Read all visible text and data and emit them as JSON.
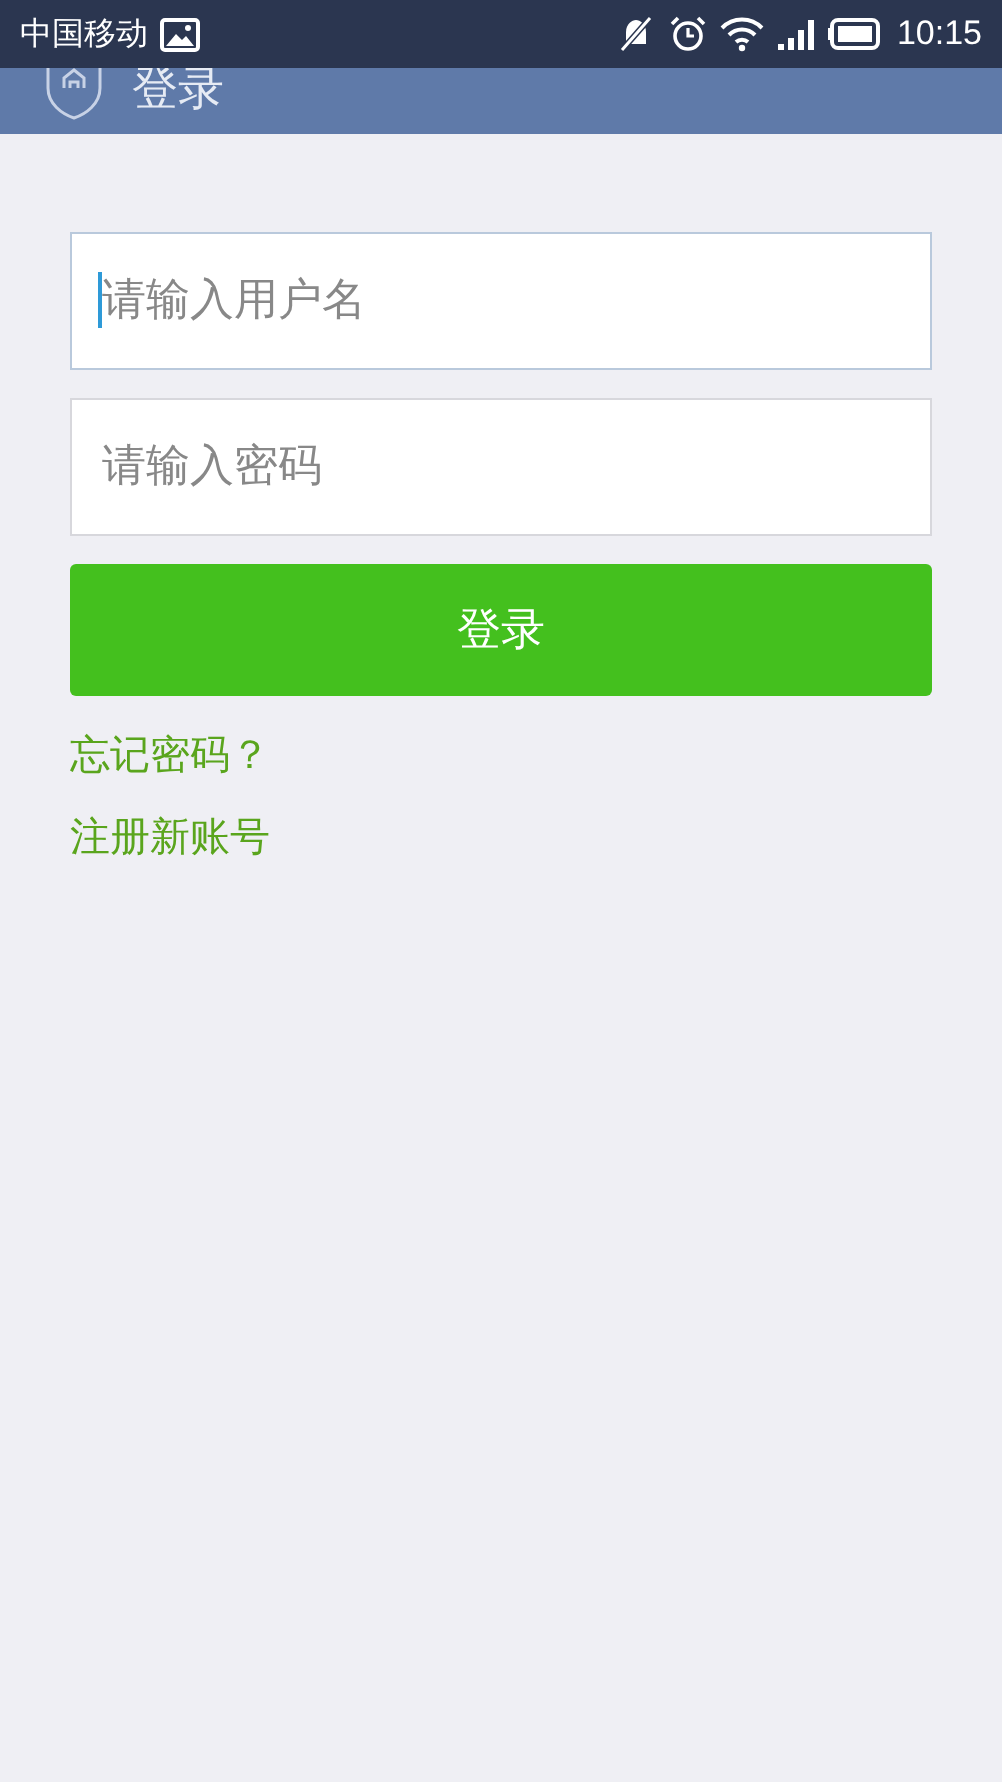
{
  "status_bar": {
    "carrier": "中国移动",
    "time": "10:15"
  },
  "app_bar": {
    "title": "登录"
  },
  "fields": [
    {
      "placeholder": "请输入用户名",
      "focused": true
    },
    {
      "placeholder": "请输入密码",
      "focused": false
    }
  ],
  "login_button": "登录",
  "links": [
    "忘记密码？",
    "注册新账号"
  ]
}
